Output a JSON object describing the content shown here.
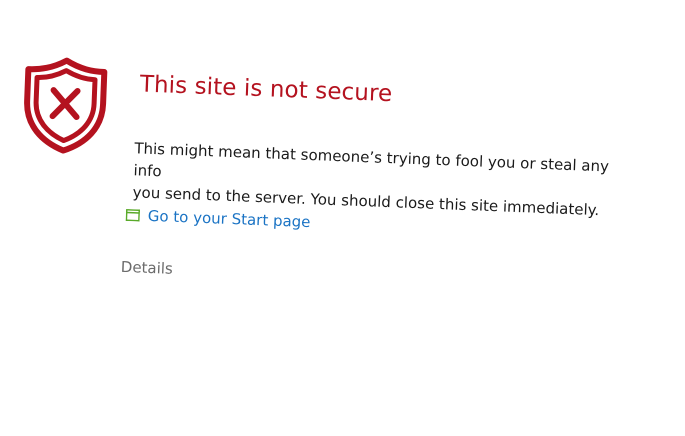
{
  "error": {
    "title": "This site is not secure",
    "message_line1": "This might mean that someone’s trying to fool you or steal any info",
    "message_line2": "you send to the server. You should close this site immediately.",
    "start_link_label": "Go to your Start page",
    "details_label": "Details"
  },
  "icons": {
    "shield": "shield-error-icon",
    "window": "window-icon"
  },
  "colors": {
    "danger": "#b4121f",
    "link": "#1a73c4",
    "link_icon": "#5aaa2a",
    "muted": "#6b6b6b"
  }
}
